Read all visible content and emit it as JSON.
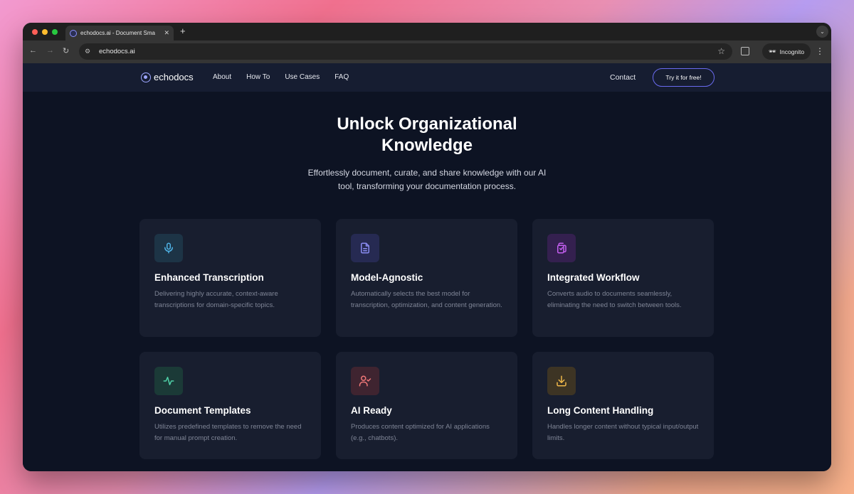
{
  "browser": {
    "tab_title": "echodocs.ai - Document Sma",
    "url": "echodocs.ai",
    "incognito_label": "Incognito"
  },
  "nav": {
    "brand": "echodocs",
    "links": [
      "About",
      "How To",
      "Use Cases",
      "FAQ"
    ],
    "contact": "Contact",
    "cta": "Try it for free!"
  },
  "hero": {
    "title": "Unlock Organizational Knowledge",
    "subtitle": "Effortlessly document, curate, and share knowledge with our AI tool, transforming your documentation process."
  },
  "features": [
    {
      "icon": "microphone-icon",
      "color": "#4fb3e6",
      "bg": "#1d3446",
      "title": "Enhanced Transcription",
      "desc": "Delivering highly accurate, context-aware transcriptions for domain-specific topics."
    },
    {
      "icon": "document-icon",
      "color": "#8a8cf2",
      "bg": "#262a52",
      "title": "Model-Agnostic",
      "desc": "Automatically selects the best model for transcription, optimization, and content generation."
    },
    {
      "icon": "files-icon",
      "color": "#c45ff0",
      "bg": "#34204f",
      "title": "Integrated Workflow",
      "desc": "Converts audio to documents seamlessly, eliminating the need to switch between tools."
    },
    {
      "icon": "activity-icon",
      "color": "#4fd0a7",
      "bg": "#1b3a37",
      "title": "Document Templates",
      "desc": "Utilizes predefined templates to remove the need for manual prompt creation."
    },
    {
      "icon": "user-check-icon",
      "color": "#f07878",
      "bg": "#3f2430",
      "title": "AI Ready",
      "desc": "Produces content optimized for AI applications (e.g., chatbots)."
    },
    {
      "icon": "download-icon",
      "color": "#f0b84a",
      "bg": "#3d3424",
      "title": "Long Content Handling",
      "desc": "Handles longer content without typical input/output limits."
    }
  ]
}
